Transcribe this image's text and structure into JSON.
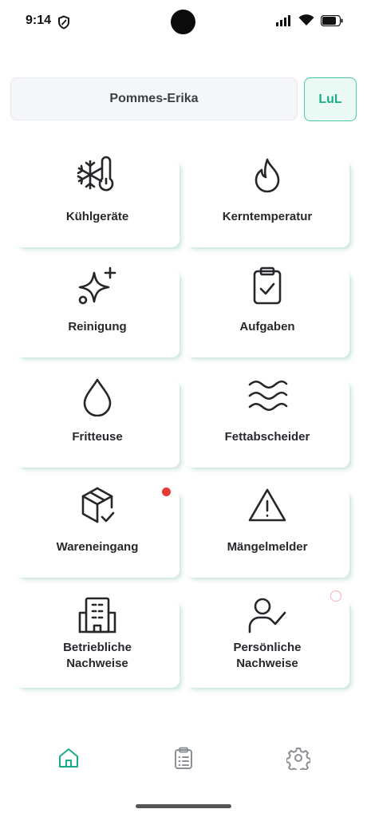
{
  "status_bar": {
    "time": "9:14",
    "left_icon": "shield-icon",
    "right_icons": [
      "signal-icon",
      "wifi-icon",
      "battery-icon"
    ]
  },
  "header": {
    "user_name": "Pommes-Erika",
    "initials_button": "LuL"
  },
  "tiles": [
    {
      "label": "Kühlgeräte",
      "icon": "snowflake-thermometer-icon"
    },
    {
      "label": "Kerntemperatur",
      "icon": "flame-icon"
    },
    {
      "label": "Reinigung",
      "icon": "sparkles-icon"
    },
    {
      "label": "Aufgaben",
      "icon": "clipboard-check-icon"
    },
    {
      "label": "Fritteuse",
      "icon": "droplet-icon"
    },
    {
      "label": "Fettabscheider",
      "icon": "waves-icon"
    },
    {
      "label": "Wareneingang",
      "icon": "package-check-icon"
    },
    {
      "label": "Mängelmelder",
      "icon": "warning-triangle-icon"
    },
    {
      "label": "Betriebliche\nNachweise",
      "icon": "building-icon"
    },
    {
      "label": "Persönliche\nNachweise",
      "icon": "user-check-icon"
    }
  ],
  "bottom_nav": {
    "items": [
      {
        "icon": "home-icon",
        "active": true
      },
      {
        "icon": "clipboard-list-icon",
        "active": false
      },
      {
        "icon": "settings-gear-icon",
        "active": false
      }
    ]
  },
  "colors": {
    "accent": "#1cab8a",
    "accent_bg": "#ecfaf5",
    "badge": "#e53935",
    "icon_inactive": "#8c9096"
  }
}
